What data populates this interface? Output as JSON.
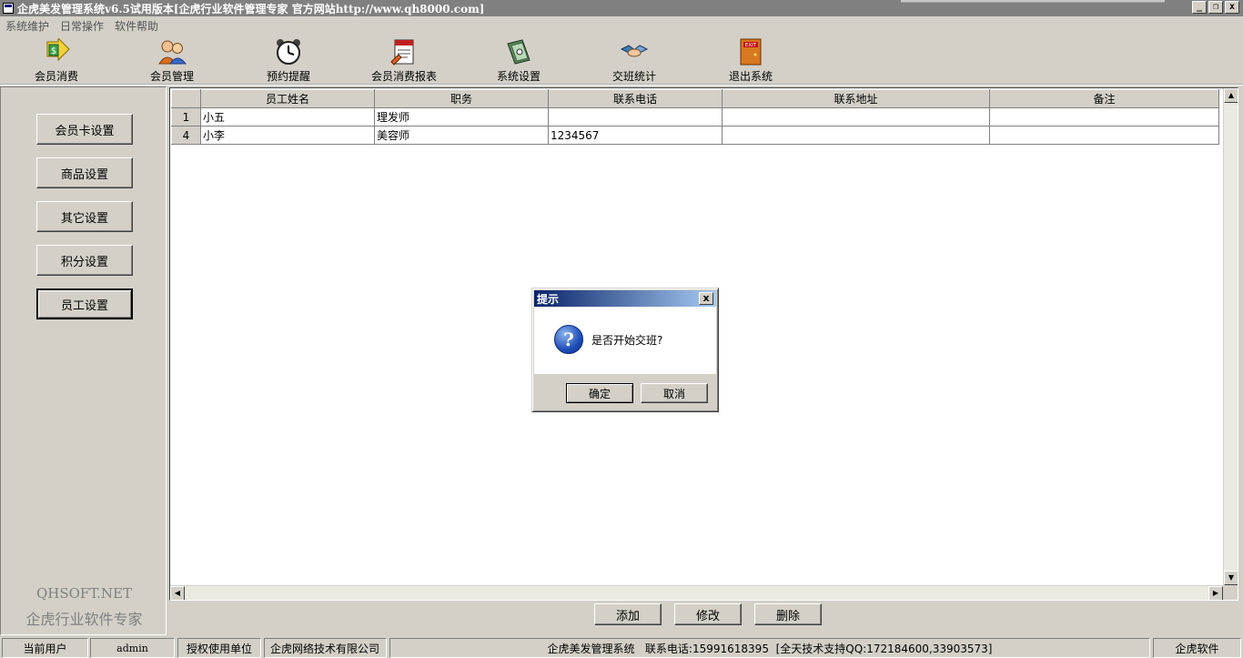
{
  "window": {
    "title": "企虎美发管理系统v6.5试用版本[企虎行业软件管理专家 官方网站http://www.qh8000.com]",
    "btn_min": "_",
    "btn_max": "❐",
    "btn_close": "x"
  },
  "menu": [
    "系统维护",
    "日常操作",
    "软件帮助"
  ],
  "toolbar": [
    {
      "label": "会员消费",
      "icon": "money-arrow-icon"
    },
    {
      "label": "会员管理",
      "icon": "users-icon"
    },
    {
      "label": "预约提醒",
      "icon": "alarm-clock-icon"
    },
    {
      "label": "会员消费报表",
      "icon": "report-icon"
    },
    {
      "label": "系统设置",
      "icon": "settings-book-icon"
    },
    {
      "label": "交班统计",
      "icon": "handshake-icon"
    },
    {
      "label": "退出系统",
      "icon": "exit-door-icon",
      "exit_text": "EXIT"
    }
  ],
  "sidebar": {
    "buttons": [
      "会员卡设置",
      "商品设置",
      "其它设置",
      "积分设置",
      "员工设置"
    ],
    "active": "员工设置",
    "brand_en": "QHSOFT.NET",
    "brand_cn": "企虎行业软件专家"
  },
  "grid": {
    "columns": [
      "员工姓名",
      "职务",
      "联系电话",
      "联系地址",
      "备注"
    ],
    "rows": [
      {
        "num": "1",
        "cells": [
          "小五",
          "理发师",
          "",
          "",
          ""
        ]
      },
      {
        "num": "4",
        "cells": [
          "小李",
          "美容师",
          "1234567",
          "",
          ""
        ]
      }
    ],
    "scroll_up": "▲",
    "scroll_down": "▼",
    "scroll_left": "◀",
    "scroll_right": "▶"
  },
  "actions": {
    "add": "添加",
    "edit": "修改",
    "delete": "删除"
  },
  "dialog": {
    "title": "提示",
    "close": "x",
    "icon": "question-icon",
    "icon_glyph": "?",
    "message": "是否开始交班?",
    "ok": "确定",
    "cancel": "取消"
  },
  "status": {
    "current_user_label": "当前用户",
    "current_user": "admin",
    "licensed_label": "授权使用单位",
    "licensed_org": "企虎网络技术有限公司",
    "info": "企虎美发管理系统   联系电话:15991618395  [全天技术支持QQ:172184600,33903573]",
    "vendor": "企虎软件"
  },
  "colors": {
    "face": "#d4d0c8",
    "titlebar_inactive": "#808080",
    "dialog_title_start": "#0a246a",
    "dialog_title_end": "#a6caf0"
  }
}
